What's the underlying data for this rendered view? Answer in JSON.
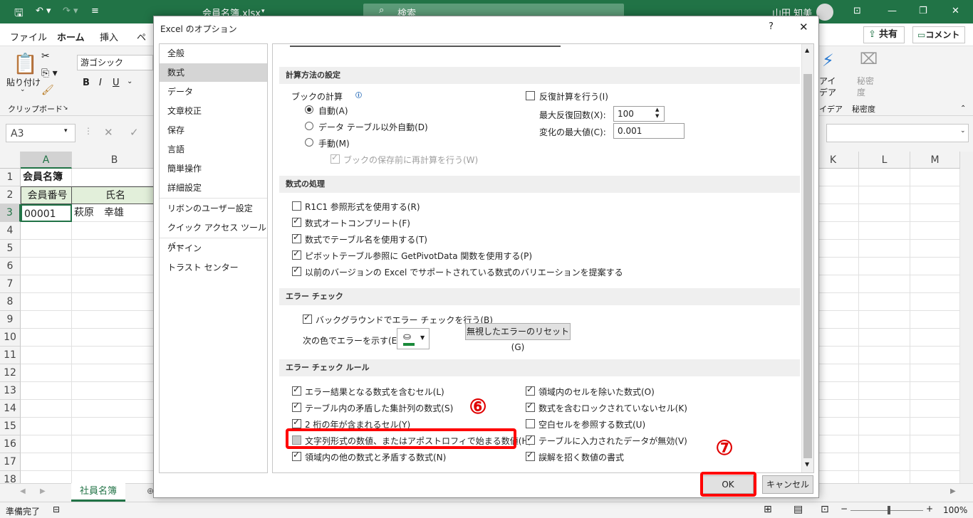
{
  "window": {
    "title": "会員名簿.xlsx",
    "search_label": "検索",
    "user": "山田 知美"
  },
  "ribbon_tabs": [
    "ファイル",
    "ホーム",
    "挿入",
    "ペ"
  ],
  "ribbon": {
    "share": "共有",
    "comment": "コメント",
    "paste": "貼り付け",
    "clipboard": "クリップボード",
    "font_name": "游ゴシック",
    "bold": "B",
    "italic": "I",
    "underline": "U",
    "idea_top": "アイ",
    "idea_bottom": "デア",
    "idea_group": "イデア",
    "sensitivity_top": "秘密",
    "sensitivity_bottom": "度",
    "sensitivity_group": "秘密度"
  },
  "formula_bar": {
    "namebox": "A3"
  },
  "grid": {
    "columns_left": [
      "A",
      "B"
    ],
    "columns_right": [
      "K",
      "L",
      "M"
    ],
    "rows": [
      "1",
      "2",
      "3",
      "4",
      "5",
      "6",
      "7",
      "8",
      "9",
      "10",
      "11",
      "12",
      "13",
      "14",
      "15",
      "16",
      "17",
      "18"
    ],
    "a1": "会員名簿",
    "a2": "会員番号",
    "b2": "氏名",
    "a3": "00001",
    "b3": "萩原　幸雄"
  },
  "sheet_tab": "社員名簿",
  "status": {
    "ready": "準備完了",
    "zoom": "100%"
  },
  "dialog": {
    "title": "Excel のオプション",
    "help": "?",
    "close": "✕",
    "nav": [
      "全般",
      "数式",
      "データ",
      "文章校正",
      "保存",
      "言語",
      "簡単操作",
      "詳細設定",
      "リボンのユーザー設定",
      "クイック アクセス ツール バー",
      "アドイン",
      "トラスト センター"
    ],
    "sections": {
      "calc": "計算方法の設定",
      "formulas": "数式の処理",
      "error_check": "エラー チェック",
      "error_rules": "エラー チェック ルール"
    },
    "calc": {
      "book_calc": "ブックの計算",
      "auto": "自動(A)",
      "auto_except_table": "データ テーブル以外自動(D)",
      "manual": "手動(M)",
      "recalc_before_save": "ブックの保存前に再計算を行う(W)",
      "iterative": "反復計算を行う(I)",
      "max_iter_label": "最大反復回数(X):",
      "max_iter_value": "100",
      "max_change_label": "変化の最大値(C):",
      "max_change_value": "0.001"
    },
    "formulas": [
      {
        "label": "R1C1 参照形式を使用する(R)",
        "checked": false
      },
      {
        "label": "数式オートコンプリート(F)",
        "checked": true
      },
      {
        "label": "数式でテーブル名を使用する(T)",
        "checked": true
      },
      {
        "label": "ピボットテーブル参照に GetPivotData 関数を使用する(P)",
        "checked": true
      },
      {
        "label": "以前のバージョンの Excel でサポートされている数式のバリエーションを提案する",
        "checked": true
      }
    ],
    "error_check": {
      "background": "バックグラウンドでエラー チェックを行う(B)",
      "color_label": "次の色でエラーを示す(E):",
      "reset_button": "無視したエラーのリセット(G)"
    },
    "rules_left": [
      {
        "label": "エラー結果となる数式を含むセル(L)",
        "checked": true
      },
      {
        "label": "テーブル内の矛盾した集計列の数式(S)",
        "checked": true
      },
      {
        "label": "2 桁の年が含まれるセル(Y)",
        "checked": true
      },
      {
        "label": "文字列形式の数値、またはアポストロフィで始まる数値(H)",
        "checked": false
      },
      {
        "label": "領域内の他の数式と矛盾する数式(N)",
        "checked": true
      }
    ],
    "rules_right": [
      {
        "label": "領域内のセルを除いた数式(O)",
        "checked": true
      },
      {
        "label": "数式を含むロックされていないセル(K)",
        "checked": true
      },
      {
        "label": "空白セルを参照する数式(U)",
        "checked": false
      },
      {
        "label": "テーブルに入力されたデータが無効(V)",
        "checked": true
      },
      {
        "label": "誤解を招く数値の書式",
        "checked": true
      }
    ],
    "ok": "OK",
    "cancel": "キャンセル"
  },
  "annotations": {
    "step6": "⑥",
    "step7": "⑦"
  },
  "colors": {
    "excel_green": "#217346",
    "highlight_red": "#ff0000"
  }
}
